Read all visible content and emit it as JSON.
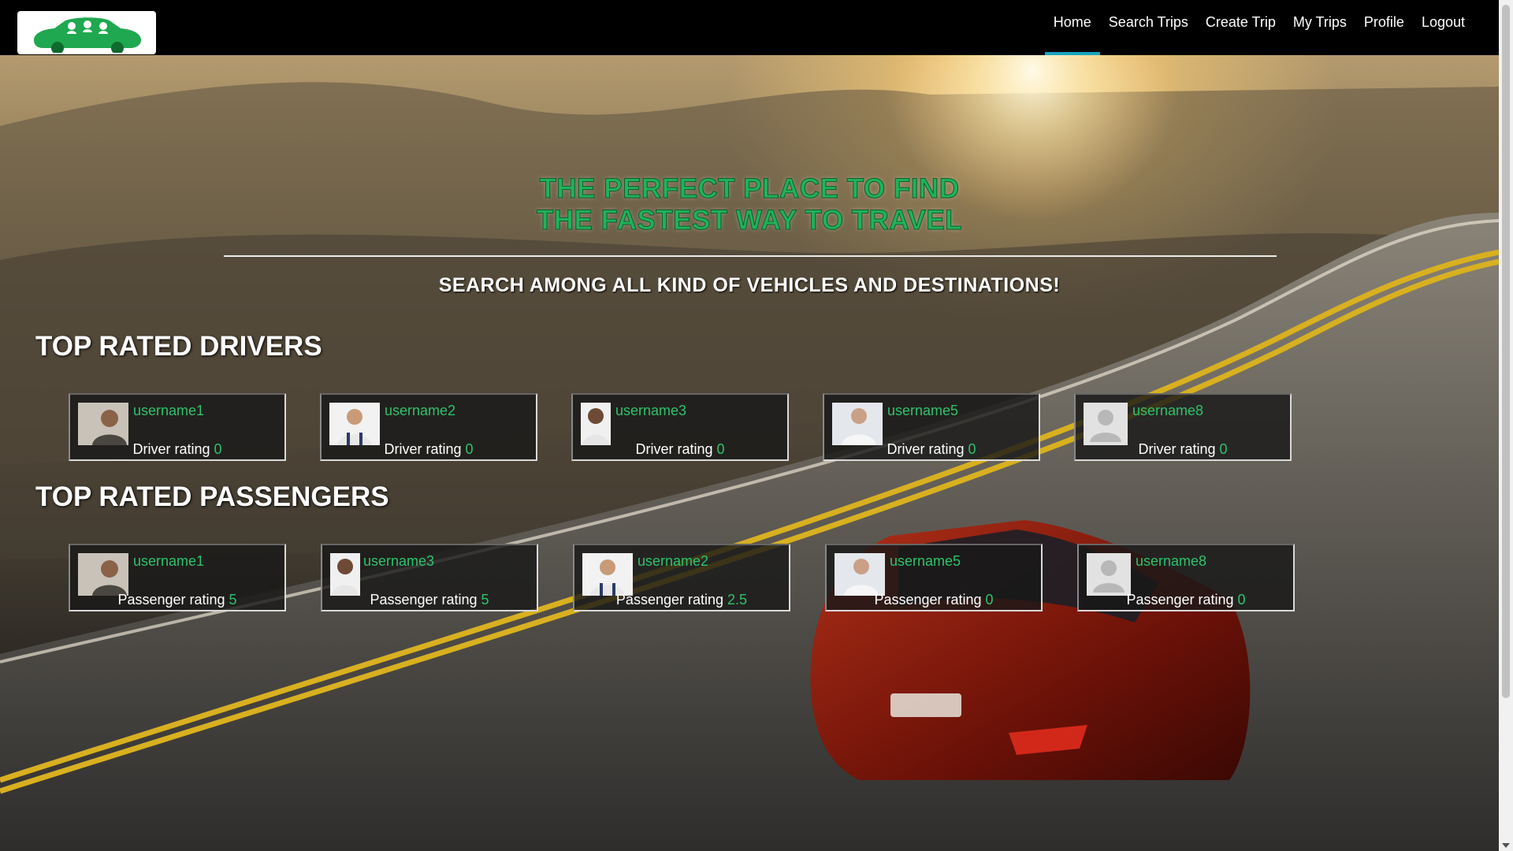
{
  "nav": {
    "items": [
      {
        "label": "Home",
        "active": true
      },
      {
        "label": "Search Trips",
        "active": false
      },
      {
        "label": "Create Trip",
        "active": false
      },
      {
        "label": "My Trips",
        "active": false
      },
      {
        "label": "Profile",
        "active": false
      },
      {
        "label": "Logout",
        "active": false
      }
    ],
    "logo_icon": "car-logo-icon"
  },
  "hero": {
    "title_line1": "THE PERFECT PLACE TO FIND",
    "title_line2": "THE FASTEST WAY TO TRAVEL",
    "subtitle": "SEARCH AMONG ALL KIND OF VEHICLES AND DESTINATIONS!"
  },
  "drivers": {
    "title": "TOP RATED DRIVERS",
    "rating_label": "Driver rating",
    "cards": [
      {
        "username": "username1",
        "rating": "0",
        "avatar": "photo-man-beard"
      },
      {
        "username": "username2",
        "rating": "0",
        "avatar": "photo-man-overalls"
      },
      {
        "username": "username3",
        "rating": "0",
        "avatar": "photo-man-curly"
      },
      {
        "username": "username5",
        "rating": "0",
        "avatar": "photo-man-shirt"
      },
      {
        "username": "username8",
        "rating": "0",
        "avatar": "default-user-icon"
      }
    ]
  },
  "passengers": {
    "title": "TOP RATED PASSENGERS",
    "rating_label": "Passenger rating",
    "cards": [
      {
        "username": "username1",
        "rating": "5",
        "avatar": "photo-man-beard"
      },
      {
        "username": "username3",
        "rating": "5",
        "avatar": "photo-man-curly"
      },
      {
        "username": "username2",
        "rating": "2.5",
        "avatar": "photo-man-overalls"
      },
      {
        "username": "username5",
        "rating": "0",
        "avatar": "photo-man-shirt"
      },
      {
        "username": "username8",
        "rating": "0",
        "avatar": "default-user-icon"
      }
    ]
  },
  "colors": {
    "accent_green": "#2fc26a",
    "nav_active": "#1aa3c0",
    "navbar_bg": "#000000"
  }
}
